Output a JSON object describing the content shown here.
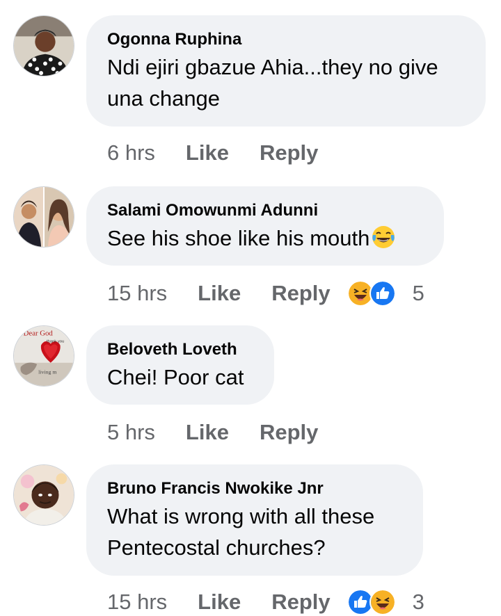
{
  "comments": [
    {
      "author": "Ogonna Ruphina",
      "text": "Ndi ejiri gbazue Ahia...they no give\nuna change",
      "time": "6 hrs",
      "like_label": "Like",
      "reply_label": "Reply"
    },
    {
      "author": "Salami Omowunmi Adunni",
      "text": "See his shoe like his mouth",
      "emoji": "laughing-tears-emoji",
      "time": "15 hrs",
      "like_label": "Like",
      "reply_label": "Reply",
      "reactions": [
        "haha-reaction-icon",
        "like-reaction-icon"
      ],
      "reaction_count": "5"
    },
    {
      "author": "Beloveth Loveth",
      "text": "Chei! Poor cat",
      "time": "5 hrs",
      "like_label": "Like",
      "reply_label": "Reply"
    },
    {
      "author": "Bruno Francis Nwokike Jnr",
      "text": "What is wrong with all these\nPentecostal churches?",
      "time": "15 hrs",
      "like_label": "Like",
      "reply_label": "Reply",
      "reactions": [
        "like-reaction-icon",
        "haha-reaction-icon"
      ],
      "reaction_count": "3"
    }
  ],
  "avatar_text": {
    "beloveth": [
      "Dear God",
      "thank you",
      "living m"
    ]
  },
  "colors": {
    "bubble": "#f0f2f5",
    "meta_text": "#65676b",
    "like_blue": "#1877f2",
    "haha_yellow": "#f7b125"
  }
}
